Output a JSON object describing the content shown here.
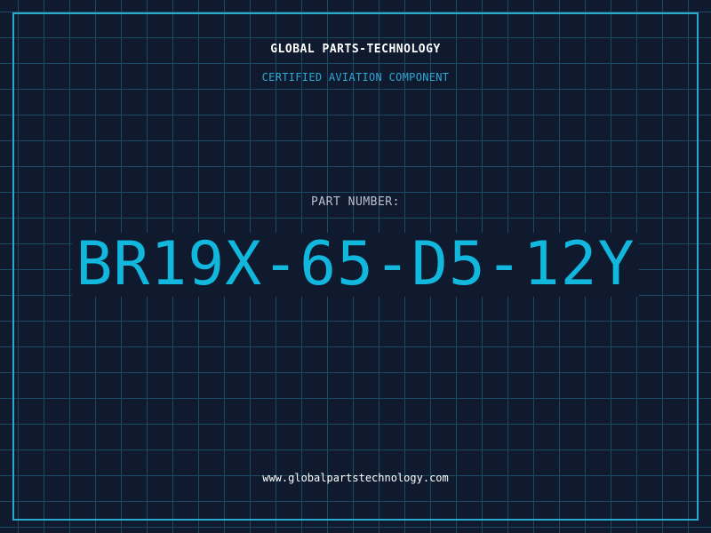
{
  "header": {
    "company": "GLOBAL PARTS-TECHNOLOGY",
    "tagline": "CERTIFIED AVIATION COMPONENT"
  },
  "part": {
    "label": "PART NUMBER:",
    "number": "BR19X-65-D5-12Y"
  },
  "footer": {
    "website": "www.globalpartstechnology.com"
  },
  "colors": {
    "background": "#0f1a2e",
    "grid_line": "#1d4a63",
    "border": "#29a9cc",
    "accent": "#12b7dd"
  }
}
